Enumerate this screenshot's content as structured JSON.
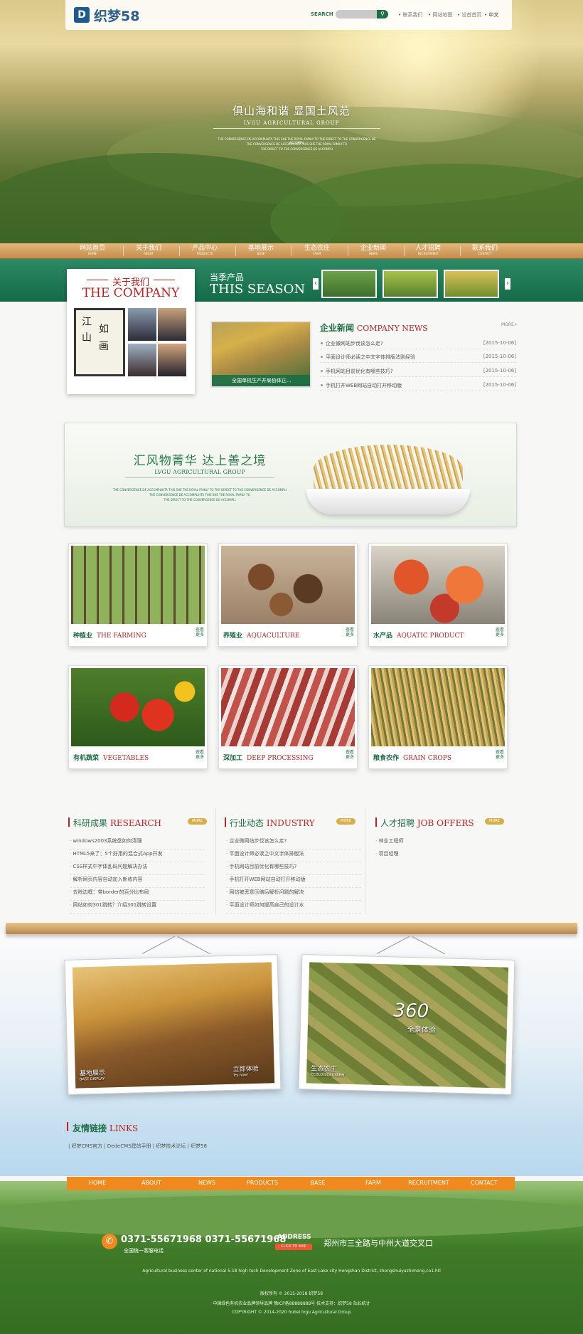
{
  "header": {
    "logo_mark": "D",
    "logo_text": "织梦58",
    "search_label": "SEARCH",
    "search_placeholder": "",
    "search_button": "⚲",
    "links": [
      "联系我们",
      "网站地图",
      "设首首页",
      "中文"
    ]
  },
  "hero": {
    "title": "俱山海和谐 显国土风范",
    "subtitle": "LVGU AGRICULTURAL GROUP",
    "small_lines": [
      "THE CONVERGENCE DE ACCOMPLIHTA THIS SHE THE ROYAL FAMILY TO THE DIRECT TO THE CONVERGENCE DE ACCOMPLI",
      "THE CONVERGENCE DE ACCOMPLIHTA THIS SHE THE ROYAL FAMILY TO",
      "THE DIRECT TO THE CONVERGENCE DE ACCOMPLI"
    ]
  },
  "nav": [
    {
      "cn": "网站首页",
      "en": "HOME"
    },
    {
      "cn": "关于我们",
      "en": "ABOUT"
    },
    {
      "cn": "产品中心",
      "en": "PRODUCTS"
    },
    {
      "cn": "基地展示",
      "en": "BASE"
    },
    {
      "cn": "生态农庄",
      "en": "FARM"
    },
    {
      "cn": "企业新闻",
      "en": "NEWS"
    },
    {
      "cn": "人才招聘",
      "en": "RECRUITMENT"
    },
    {
      "cn": "联系我们",
      "en": "CONTACT"
    }
  ],
  "about": {
    "title_cn": "关于我们",
    "title_en": "THE COMPANY",
    "calligraphy": [
      "江",
      "山",
      "如",
      "画"
    ]
  },
  "season": {
    "title_cn": "当季产品",
    "title_en": "THIS SEASON",
    "prev": "‹",
    "next": "›"
  },
  "news": {
    "title_cn": "企业新闻",
    "title_en": "COMPANY NEWS",
    "more": "MORE+",
    "image_caption": "全国单机生产开局协体正...",
    "items": [
      {
        "title": "企业微网站步伐该怎么走?",
        "date": "[2015-10-06]"
      },
      {
        "title": "平面设计师必读之中文字体排版法则经验",
        "date": "[2015-10-06]"
      },
      {
        "title": "手机网站目前优化有哪些技巧?",
        "date": "[2015-10-06]"
      },
      {
        "title": "手机打开WEB网站自动打开移动版",
        "date": "[2015-10-06]"
      }
    ]
  },
  "banner": {
    "title": "汇风物菁华 达上善之境",
    "subtitle": "LVGU AGRICULTURAL GROUP",
    "small_lines": [
      "THE CONVERGENCE DE ACCOMPLIHTA THIS SHE THE ROYAL FAMILY TO THE DIRECT TO THE CONVERGENCE DE ACCOMPLI",
      "THE CONVERGENCE DE ACCOMPLIHTA THIS SHE THE ROYAL FAMILY TO",
      "THE DIRECT TO THE CONVERGENCE DE ACCOMPLI"
    ]
  },
  "products": [
    {
      "cn": "种植业",
      "en": "THE FARMING",
      "more": "查看更多"
    },
    {
      "cn": "养殖业",
      "en": "AQUACULTURE",
      "more": "查看更多"
    },
    {
      "cn": "水产品",
      "en": "AQUATIC PRODUCT",
      "more": "查看更多"
    },
    {
      "cn": "有机蔬菜",
      "en": "VEGETABLES",
      "more": "查看更多"
    },
    {
      "cn": "深加工",
      "en": "DEEP PROCESSING",
      "more": "查看更多"
    },
    {
      "cn": "粮食农作",
      "en": "GRAIN CROPS",
      "more": "查看更多"
    }
  ],
  "columns": [
    {
      "cn": "科研成果",
      "en": "RESEARCH",
      "more": "MORE",
      "items": [
        "windows2003系统盘如何清理",
        "HTML5来了：5个好用的混合式App开发",
        "CSS样式中字体乱码问题解决办法",
        "解析网页内容自动加入新收内容",
        "去除边框：带border的百分比布局",
        "网站如何301跳转？介绍301跳转设置"
      ]
    },
    {
      "cn": "行业动态",
      "en": "INDUSTRY",
      "more": "MORE",
      "items": [
        "企业微网站步伐该怎么走?",
        "平面设计师必读之中文字体排版法",
        "手机网站目前优化有哪些技巧?",
        "手机打开WEB网站自动打开移动版",
        "网站被恶意压缩后解析问题的解决",
        "平面设计师如何提高自己的设计水"
      ]
    },
    {
      "cn": "人才招聘",
      "en": "JOB OFFERS",
      "more": "MORE",
      "items": [
        "林业工程师",
        "项目经理"
      ]
    }
  ],
  "frames": [
    {
      "cn": "基地展示",
      "en": "BASE DISPLAY",
      "cta_cn": "立即体验",
      "cta_en": "Try now!"
    },
    {
      "cn": "生态农庄",
      "en": "ECOLOGICAL FARM",
      "badge": "360",
      "badge_cn": "全景体验"
    }
  ],
  "links": {
    "title_cn": "友情链接",
    "title_en": "LINKS",
    "items": "| 织梦CMS官方 | DedeCMS建站手册 | 织梦技术论坛 | 织梦58"
  },
  "footer": {
    "nav": [
      "HOME",
      "ABOUT",
      "NEWS",
      "PRODUCTS",
      "BASE",
      "FARM",
      "RECRUITMENT",
      "CONTACT"
    ],
    "phone": "0371-55671968  0371-55671968",
    "phone_sub": "全国统一客服电话",
    "addr_label": "ADDRESS",
    "addr_btn": "CLICK TO MAP",
    "address": "郑州市三全路与中州大道交叉口",
    "lines": [
      "Agricultural business center of national 5.18 high tech Development Zone of East Lake city Hongshan District, zhongshuiyuzhimeng.co1.htl",
      "版权所有 © 2015-2018 织梦58",
      "中国绿色有机农业品牌领导品牌 豫ICP备88888888号 技术支持：织梦58 站长统计",
      "COPYRIGHT © 2014-2020 hubei lvgu Agricultural Group"
    ]
  }
}
